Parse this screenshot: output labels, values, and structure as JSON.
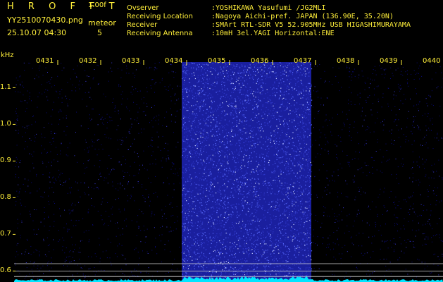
{
  "header": {
    "app_title": "H R O F F T",
    "version": "1.00f",
    "filename": "YY2510070430.png",
    "timestamp": "25.10.07 04:30",
    "meteor_label": "meteor",
    "meteor_count": "5"
  },
  "info": [
    {
      "label": "Ovserver",
      "value": ":YOSHIKAWA Yasufumi /JG2MLI"
    },
    {
      "label": "Receiving Location",
      "value": ":Nagoya Aichi-pref. JAPAN (136.90E, 35.20N)"
    },
    {
      "label": "Receiver",
      "value": ":SMArt RTL-SDR V5 52.905MHz USB HIGASHIMURAYAMA"
    },
    {
      "label": "Receiving Antenna",
      "value": ":10mH 3el.YAGI Horizontal:ENE"
    }
  ],
  "colors": {
    "text_yellow": "#ffef3a",
    "text_green": "#3cff5a",
    "background": "#000000",
    "background_noise": "#0a0a7a",
    "active_noise": "#2d36c8",
    "baseline": "#00e5ff"
  },
  "chart_data": {
    "type": "heatmap",
    "ylabel": "kHz",
    "time_labels": [
      "0431",
      "0432",
      "0433",
      "0434",
      "0435",
      "0436",
      "0437",
      "0438",
      "0439",
      "0440"
    ],
    "y_ticks": [
      "1.1",
      "1.0",
      "0.9",
      "0.8",
      "0.7",
      "0.6"
    ],
    "ylim": [
      0.57,
      1.17
    ],
    "active_band_minutes": [
      "0435",
      "0436"
    ],
    "reference_lines_khz": [
      0.62,
      0.6,
      0.585
    ]
  }
}
